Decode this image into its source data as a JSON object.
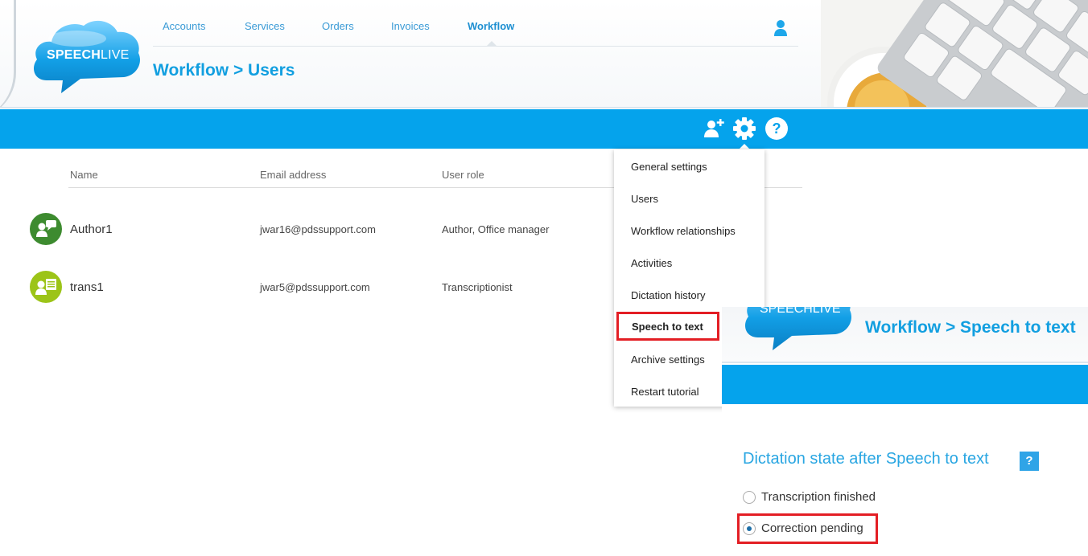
{
  "logo": {
    "speech": "SPEECH",
    "live": "LIVE"
  },
  "nav": {
    "items": [
      {
        "label": "Accounts"
      },
      {
        "label": "Services"
      },
      {
        "label": "Orders"
      },
      {
        "label": "Invoices"
      },
      {
        "label": "Workflow",
        "active": true
      }
    ]
  },
  "page": {
    "title": "Workflow > Users"
  },
  "toolbar": {
    "icons": [
      "add-user-icon",
      "gear-icon",
      "help-icon"
    ],
    "help_glyph": "?"
  },
  "table": {
    "headers": [
      "Name",
      "Email address",
      "User role"
    ],
    "rows": [
      {
        "name": "Author1",
        "email": "jwar16@pdssupport.com",
        "role": "Author, Office manager",
        "avatar_color": "#3d8b2f"
      },
      {
        "name": "trans1",
        "email": "jwar5@pdssupport.com",
        "role": "Transcriptionist",
        "avatar_color": "#9cc418"
      }
    ]
  },
  "settings_menu": {
    "items": [
      "General settings",
      "Users",
      "Workflow relationships",
      "Activities",
      "Dictation history",
      "Speech to text",
      "Archive settings",
      "Restart tutorial"
    ],
    "highlighted": "Speech to text"
  },
  "inset": {
    "logo": {
      "speech": "SPEECH",
      "live": "LIVE"
    },
    "title": "Workflow > Speech to text",
    "section_title": "Dictation state after Speech to text",
    "help_glyph": "?",
    "options": [
      {
        "label": "Transcription finished",
        "checked": false
      },
      {
        "label": "Correction pending",
        "checked": true
      }
    ]
  },
  "colors": {
    "brand_blue": "#05a3ec",
    "title_blue": "#129fe0",
    "highlight_red": "#e31e24"
  }
}
